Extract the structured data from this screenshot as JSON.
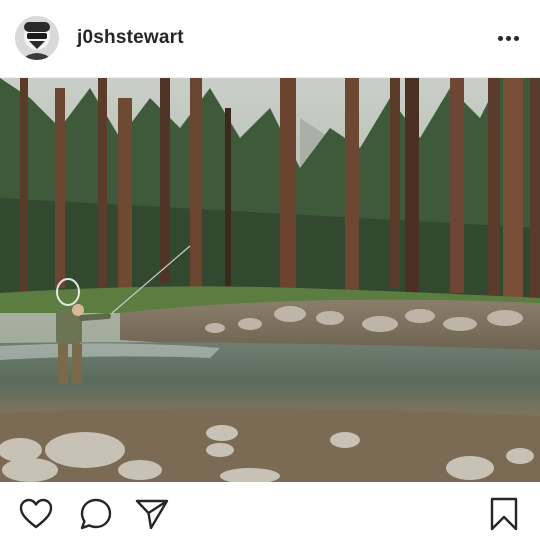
{
  "post": {
    "username": "j0shstewart",
    "image_description_icon": "fly-fishing-river-photo"
  },
  "header": {
    "avatar_icon": "stormtrooper-avatar",
    "more_icon": "more-options-icon"
  },
  "actions": {
    "like_icon": "heart-icon",
    "comment_icon": "comment-bubble-icon",
    "share_icon": "paper-plane-icon",
    "save_icon": "bookmark-icon"
  },
  "colors": {
    "text": "#262626",
    "divider": "#efefef"
  }
}
